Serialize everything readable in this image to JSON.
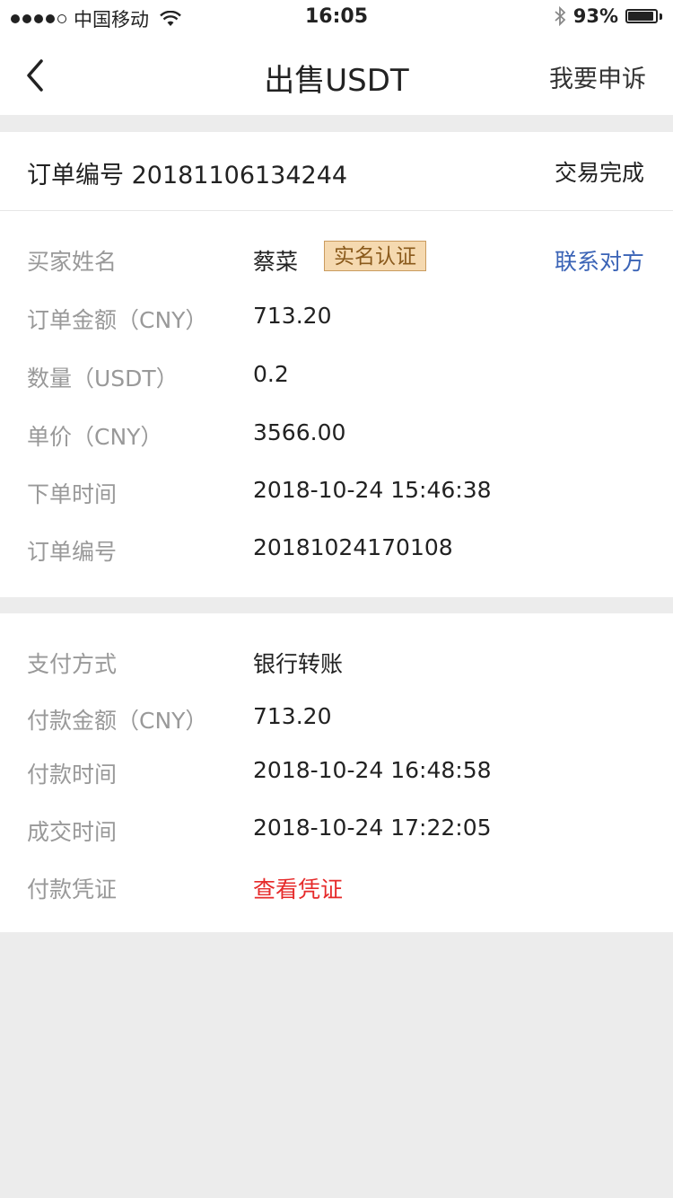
{
  "status_bar": {
    "carrier": "中国移动",
    "time": "16:05",
    "battery_percent": "93%",
    "battery_level": 0.93,
    "icons": [
      "signal-dots",
      "wifi-icon",
      "bluetooth-icon",
      "battery-icon"
    ]
  },
  "nav": {
    "title": "出售USDT",
    "appeal_label": "我要申诉",
    "back_icon": "chevron-left-icon"
  },
  "order": {
    "order_no_text": "订单编号 20181106134244",
    "status": "交易完成",
    "buyer_label": "买家姓名",
    "buyer_name": "蔡菜",
    "verified_label": "实名认证",
    "contact_label": "联系对方",
    "rows": [
      {
        "label": "订单金额（CNY）",
        "value": "713.20"
      },
      {
        "label": "数量（USDT）",
        "value": "0.2"
      },
      {
        "label": "单价（CNY）",
        "value": "3566.00"
      },
      {
        "label": "下单时间",
        "value": "2018-10-24 15:46:38"
      },
      {
        "label": "订单编号",
        "value": "20181024170108"
      }
    ]
  },
  "payment": {
    "rows": [
      {
        "label": "支付方式",
        "value": "银行转账"
      },
      {
        "label": "付款金额（CNY）",
        "value": "713.20"
      },
      {
        "label": "付款时间",
        "value": "2018-10-24 16:48:58"
      },
      {
        "label": "成交时间",
        "value": "2018-10-24 17:22:05"
      }
    ],
    "proof_label": "付款凭证",
    "proof_link": "查看凭证"
  },
  "colors": {
    "link_blue": "#3a63b6",
    "link_red": "#e62a2a",
    "badge_bg": "#f5d9b0",
    "label_gray": "#999999",
    "page_bg": "#ececec"
  }
}
